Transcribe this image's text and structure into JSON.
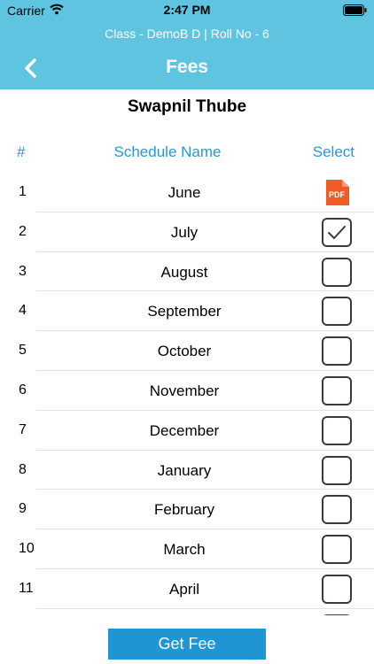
{
  "status_bar": {
    "carrier": "Carrier",
    "time": "2:47 PM"
  },
  "header": {
    "subtitle": "Class - DemoB D | Roll No - 6",
    "title": "Fees",
    "background": "#5fc4e0"
  },
  "student": {
    "name": "Swapnil Thube"
  },
  "table": {
    "columns": {
      "number": "#",
      "name": "Schedule Name",
      "select": "Select"
    },
    "rows": [
      {
        "number": "1",
        "name": "June",
        "select": "pdf"
      },
      {
        "number": "2",
        "name": "July",
        "select": "checked"
      },
      {
        "number": "3",
        "name": "August",
        "select": "unchecked"
      },
      {
        "number": "4",
        "name": "September",
        "select": "unchecked"
      },
      {
        "number": "5",
        "name": "October",
        "select": "unchecked"
      },
      {
        "number": "6",
        "name": "November",
        "select": "unchecked"
      },
      {
        "number": "7",
        "name": "December",
        "select": "unchecked"
      },
      {
        "number": "8",
        "name": "January",
        "select": "unchecked"
      },
      {
        "number": "9",
        "name": "February",
        "select": "unchecked"
      },
      {
        "number": "10",
        "name": "March",
        "select": "unchecked"
      },
      {
        "number": "11",
        "name": "April",
        "select": "unchecked"
      },
      {
        "number": "",
        "name": "",
        "select": "unchecked"
      }
    ]
  },
  "actions": {
    "get_fee_label": "Get Fee"
  },
  "icons": {
    "back": "chevron-left-icon",
    "pdf": "pdf-file-icon",
    "checkmark": "checkmark-icon",
    "wifi": "wifi-icon",
    "battery": "battery-icon"
  },
  "colors": {
    "accent": "#2b96cf",
    "button": "#1f96d3",
    "pdf": "#f15a24"
  }
}
